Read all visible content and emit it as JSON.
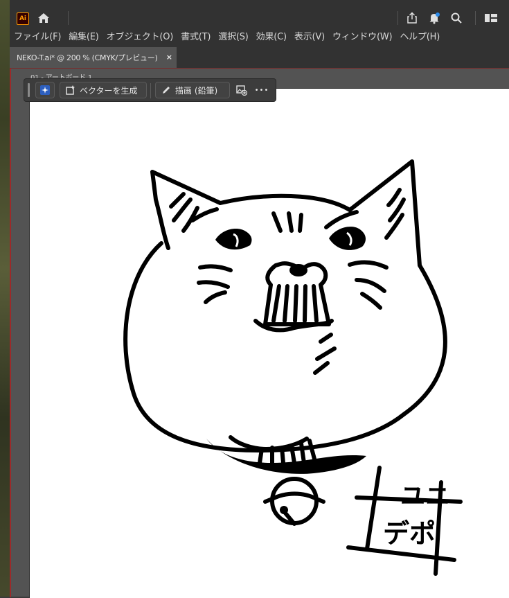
{
  "app": {
    "logo_text": "Ai"
  },
  "titlebar": {
    "icons": [
      "home-icon",
      "share-icon",
      "bell-icon",
      "search-icon",
      "layout-icon"
    ]
  },
  "menu": [
    "ファイル(F)",
    "編集(E)",
    "オブジェクト(O)",
    "書式(T)",
    "選択(S)",
    "効果(C)",
    "表示(V)",
    "ウィンドウ(W)",
    "ヘルプ(H)"
  ],
  "document_tab": {
    "label": "NEKO-T.ai* @ 200 % (CMYK/プレビュー)",
    "close": "×"
  },
  "artboard": {
    "label": "01 - アートボード 1"
  },
  "context_bar": {
    "generate_vector": "ベクターを生成",
    "draw_pencil": "描画 (鉛筆)",
    "more": "•••"
  },
  "artwork": {
    "stamp_text": [
      "ユニ",
      "デポ"
    ]
  },
  "colors": {
    "accent": "#ff9a00",
    "notification": "#2d8ceb",
    "guide": "#9c2a2a"
  }
}
